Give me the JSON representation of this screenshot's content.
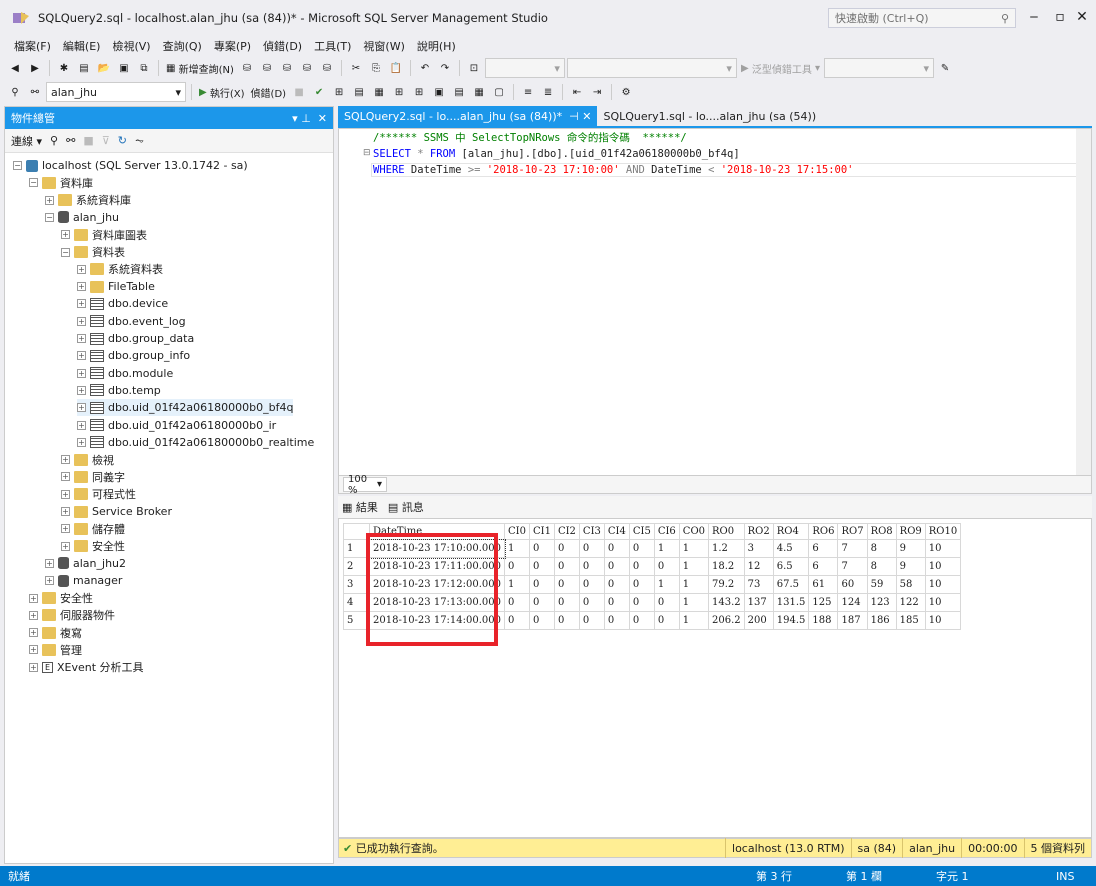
{
  "window": {
    "title": "SQLQuery2.sql - localhost.alan_jhu (sa (84))* - Microsoft SQL Server Management Studio",
    "quick_launch": "快速啟動 (Ctrl+Q)"
  },
  "menu": [
    "檔案(F)",
    "編輯(E)",
    "檢視(V)",
    "查詢(Q)",
    "專案(P)",
    "偵錯(D)",
    "工具(T)",
    "視窗(W)",
    "說明(H)"
  ],
  "toolbar1": {
    "new_query": "新增查詢(N)",
    "generic_debugger": "泛型偵錯工具"
  },
  "toolbar2": {
    "database": "alan_jhu",
    "execute": "執行(X)",
    "debug": "偵錯(D)"
  },
  "object_explorer": {
    "title": "物件總管",
    "connect": "連線",
    "nodes": [
      {
        "label": "localhost (SQL Server 13.0.1742 - sa)",
        "icon": "server-icon",
        "exp": "⊟"
      },
      {
        "label": "資料庫",
        "icon": "folder-icon",
        "exp": "⊟"
      },
      {
        "label": "系統資料庫",
        "icon": "folder-icon",
        "exp": "⊞"
      },
      {
        "label": "alan_jhu",
        "icon": "database-icon",
        "exp": "⊟"
      },
      {
        "label": "資料庫圖表",
        "icon": "folder-icon",
        "exp": "⊞"
      },
      {
        "label": "資料表",
        "icon": "folder-icon",
        "exp": "⊟"
      },
      {
        "label": "系統資料表",
        "icon": "folder-icon",
        "exp": "⊞"
      },
      {
        "label": "FileTable",
        "icon": "folder-icon",
        "exp": "⊞"
      },
      {
        "label": "dbo.device",
        "icon": "table-icon",
        "exp": "⊞"
      },
      {
        "label": "dbo.event_log",
        "icon": "table-icon",
        "exp": "⊞"
      },
      {
        "label": "dbo.group_data",
        "icon": "table-icon",
        "exp": "⊞"
      },
      {
        "label": "dbo.group_info",
        "icon": "table-icon",
        "exp": "⊞"
      },
      {
        "label": "dbo.module",
        "icon": "table-icon",
        "exp": "⊞"
      },
      {
        "label": "dbo.temp",
        "icon": "table-icon",
        "exp": "⊞"
      },
      {
        "label": "dbo.uid_01f42a06180000b0_bf4q",
        "icon": "table-icon",
        "exp": "⊞"
      },
      {
        "label": "dbo.uid_01f42a06180000b0_ir",
        "icon": "table-icon",
        "exp": "⊞"
      },
      {
        "label": "dbo.uid_01f42a06180000b0_realtime",
        "icon": "table-icon",
        "exp": "⊞"
      },
      {
        "label": "檢視",
        "icon": "folder-icon",
        "exp": "⊞"
      },
      {
        "label": "同義字",
        "icon": "folder-icon",
        "exp": "⊞"
      },
      {
        "label": "可程式性",
        "icon": "folder-icon",
        "exp": "⊞"
      },
      {
        "label": "Service Broker",
        "icon": "folder-icon",
        "exp": "⊞"
      },
      {
        "label": "儲存體",
        "icon": "folder-icon",
        "exp": "⊞"
      },
      {
        "label": "安全性",
        "icon": "folder-icon",
        "exp": "⊞"
      },
      {
        "label": "alan_jhu2",
        "icon": "database-icon",
        "exp": "⊞"
      },
      {
        "label": "manager",
        "icon": "database-icon",
        "exp": "⊞"
      },
      {
        "label": "安全性",
        "icon": "folder-icon",
        "exp": "⊞"
      },
      {
        "label": "伺服器物件",
        "icon": "folder-icon",
        "exp": "⊞"
      },
      {
        "label": "複寫",
        "icon": "folder-icon",
        "exp": "⊞"
      },
      {
        "label": "管理",
        "icon": "folder-icon",
        "exp": "⊞"
      },
      {
        "label": "XEvent 分析工具",
        "icon": "xevent-icon",
        "exp": "⊞"
      }
    ]
  },
  "tabs": [
    {
      "label": "SQLQuery2.sql - lo....alan_jhu (sa (84))*"
    },
    {
      "label": "SQLQuery1.sql - lo....alan_jhu (sa (54))"
    }
  ],
  "editor": {
    "line1": "/****** SSMS 中 SelectTopNRows 命令的指令碼  ******/",
    "line2a": "SELECT",
    "line2b": " * ",
    "line2c": "FROM",
    "line2d": " [alan_jhu].[dbo].[uid_01f42a06180000b0_bf4q]",
    "line3a": "WHERE",
    "line3b": " DateTime ",
    "line3c": ">=",
    "line3d": " '2018-10-23 17:10:00' ",
    "line3e": "AND",
    "line3f": " DateTime ",
    "line3g": "<",
    "line3h": " '2018-10-23 17:15:00'"
  },
  "zoom": "100 %",
  "result_tabs": {
    "results": "結果",
    "messages": "訊息"
  },
  "grid": {
    "columns": [
      "DateTime",
      "CI0",
      "CI1",
      "CI2",
      "CI3",
      "CI4",
      "CI5",
      "CI6",
      "CO0",
      "RO0",
      "RO2",
      "RO4",
      "RO6",
      "RO7",
      "RO8",
      "RO9",
      "RO10"
    ],
    "rows": [
      [
        "1",
        "2018-10-23 17:10:00.000",
        "1",
        "0",
        "0",
        "0",
        "0",
        "0",
        "1",
        "1",
        "1.2",
        "3",
        "4.5",
        "6",
        "7",
        "8",
        "9",
        "10"
      ],
      [
        "2",
        "2018-10-23 17:11:00.000",
        "0",
        "0",
        "0",
        "0",
        "0",
        "0",
        "0",
        "1",
        "18.2",
        "12",
        "6.5",
        "6",
        "7",
        "8",
        "9",
        "10"
      ],
      [
        "3",
        "2018-10-23 17:12:00.000",
        "1",
        "0",
        "0",
        "0",
        "0",
        "0",
        "1",
        "1",
        "79.2",
        "73",
        "67.5",
        "61",
        "60",
        "59",
        "58",
        "10"
      ],
      [
        "4",
        "2018-10-23 17:13:00.000",
        "0",
        "0",
        "0",
        "0",
        "0",
        "0",
        "0",
        "1",
        "143.2",
        "137",
        "131.5",
        "125",
        "124",
        "123",
        "122",
        "10"
      ],
      [
        "5",
        "2018-10-23 17:14:00.000",
        "0",
        "0",
        "0",
        "0",
        "0",
        "0",
        "0",
        "1",
        "206.2",
        "200",
        "194.5",
        "188",
        "187",
        "186",
        "185",
        "10"
      ]
    ]
  },
  "query_status": {
    "message": "已成功執行查詢。",
    "server": "localhost (13.0 RTM)",
    "login": "sa (84)",
    "db": "alan_jhu",
    "time": "00:00:00",
    "rows": "5 個資料列"
  },
  "statusbar": {
    "ready": "就緒",
    "line": "第 3 行",
    "col": "第 1 欄",
    "ch": "字元 1",
    "ins": "INS"
  },
  "colors": {
    "accent": "#007acc",
    "tab_active": "#1c97ea",
    "highlight": "#e8232a"
  }
}
